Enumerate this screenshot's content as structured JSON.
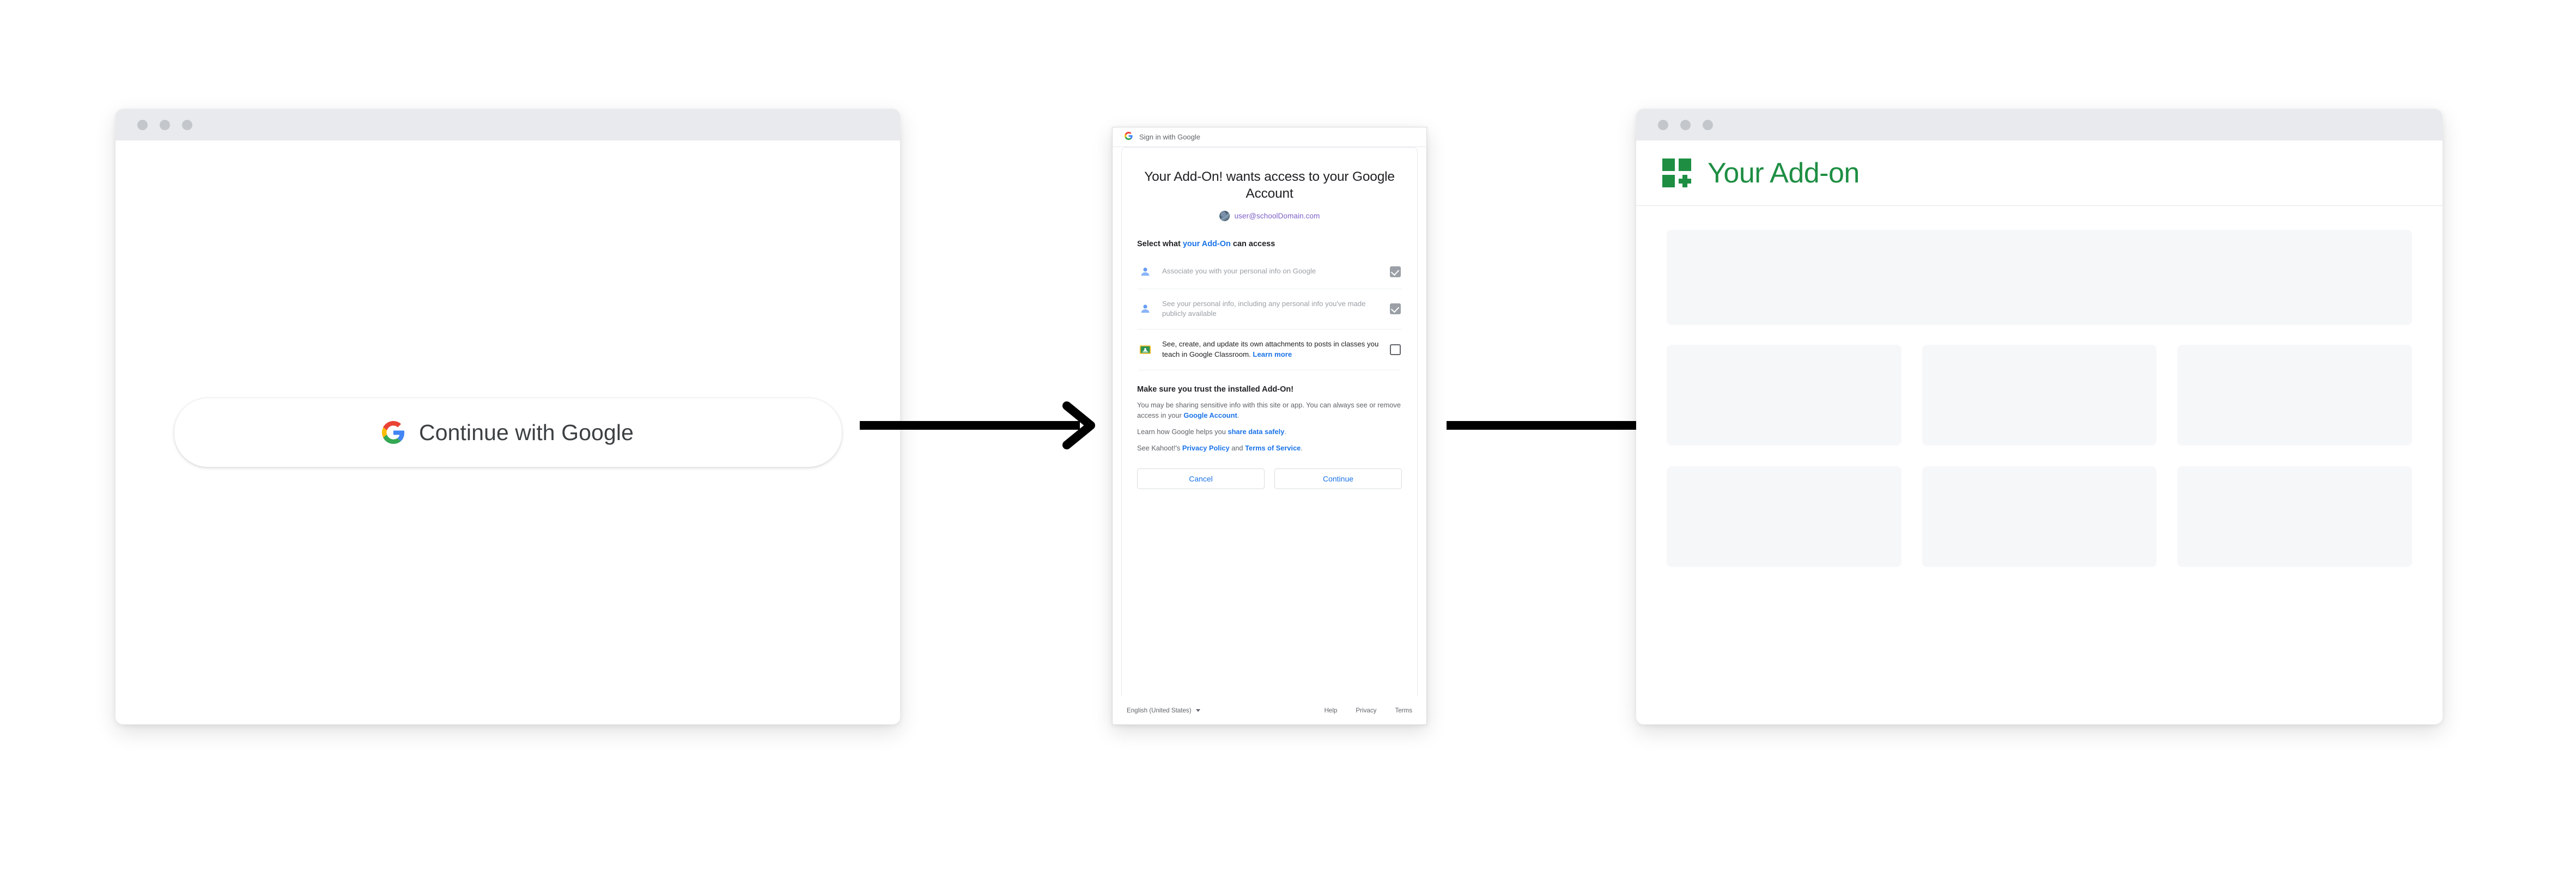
{
  "panel_signin": {
    "window_controls": [
      "close-dot",
      "minimize-dot",
      "maximize-dot"
    ],
    "button": {
      "label": "Continue with Google",
      "icon": "google-g-icon"
    }
  },
  "flow": {
    "arrow_1": "arrow-right-icon",
    "arrow_2": "arrow-right-icon"
  },
  "panel_consent": {
    "header": {
      "icon": "google-g-icon",
      "text": "Sign in with Google"
    },
    "title": "Your Add-On! wants access to your Google Account",
    "account": {
      "avatar": "user-avatar",
      "email": "user@schoolDomain.com",
      "email_color": "#7d5fc7"
    },
    "select_label_pre": "Select what ",
    "select_label_link": "your Add-On",
    "select_label_post": " can access",
    "permissions": [
      {
        "icon": "person-icon",
        "text": "Associate you with your personal info on Google",
        "checked": true,
        "disabled": true
      },
      {
        "icon": "person-icon",
        "text": "See your personal info, including any personal info you've made publicly available",
        "checked": true,
        "disabled": true
      },
      {
        "icon": "google-classroom-icon",
        "text": "See, create, and update its own attachments to posts in classes you teach in Google Classroom. ",
        "link": "Learn more",
        "checked": false,
        "disabled": false
      }
    ],
    "trust": {
      "heading": "Make sure you trust the installed Add-On!",
      "p1_a": "You may be sharing sensitive info with this site or app. You can always see or remove access in your ",
      "p1_link": "Google Account",
      "p1_b": ".",
      "p2_a": "Learn how Google helps you ",
      "p2_link": "share data safely",
      "p2_b": ".",
      "p3_a": "See Kahoot!'s ",
      "p3_link1": "Privacy Policy",
      "p3_mid": " and ",
      "p3_link2": "Terms of Service",
      "p3_b": "."
    },
    "buttons": {
      "cancel": "Cancel",
      "continue": "Continue"
    },
    "footer": {
      "language": "English (United States)",
      "language_caret": "chevron-down-icon",
      "links": [
        "Help",
        "Privacy",
        "Terms"
      ]
    },
    "accent_link_color": "#1a73e8"
  },
  "panel_addon": {
    "window_controls": [
      "close-dot",
      "minimize-dot",
      "maximize-dot"
    ],
    "logo": "addon-grid-plus-icon",
    "brand_color": "#1e8e43",
    "title": "Your Add-on",
    "placeholders": {
      "hero": "content-placeholder",
      "cards": [
        "content-placeholder",
        "content-placeholder",
        "content-placeholder",
        "content-placeholder",
        "content-placeholder",
        "content-placeholder"
      ]
    }
  }
}
